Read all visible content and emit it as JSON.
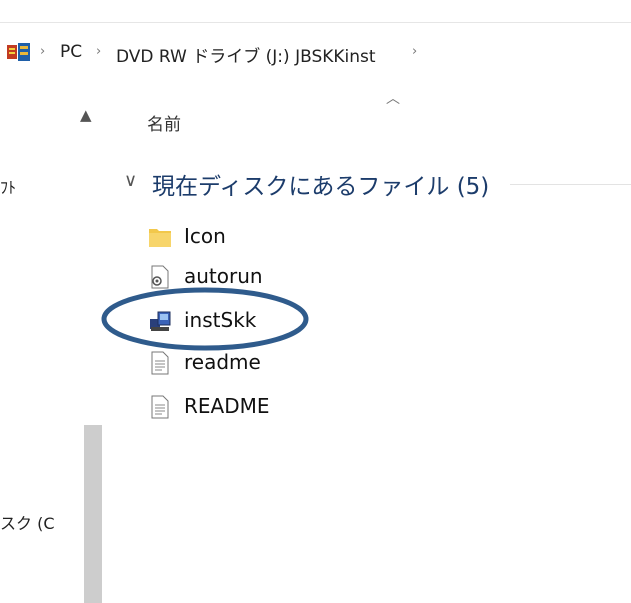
{
  "breadcrumb": {
    "items": [
      "PC",
      "DVD RW ドライブ (J:) JBSKKinst"
    ],
    "separator": "›"
  },
  "nav": {
    "labels": [
      "ﾌﾄ",
      "スク (C"
    ]
  },
  "columns": {
    "name": "名前"
  },
  "group": {
    "title": "現在ディスクにあるファイル (5)"
  },
  "files": [
    {
      "name": "Icon",
      "icon": "folder-icon"
    },
    {
      "name": "autorun",
      "icon": "settings-file-icon"
    },
    {
      "name": "instSkk",
      "icon": "installer-app-icon"
    },
    {
      "name": "readme",
      "icon": "text-document-icon"
    },
    {
      "name": "README",
      "icon": "text-document-icon"
    }
  ],
  "colors": {
    "annotation": "#2f5b8c",
    "folder": "#f2c84b",
    "group_title": "#1c3c6b"
  }
}
